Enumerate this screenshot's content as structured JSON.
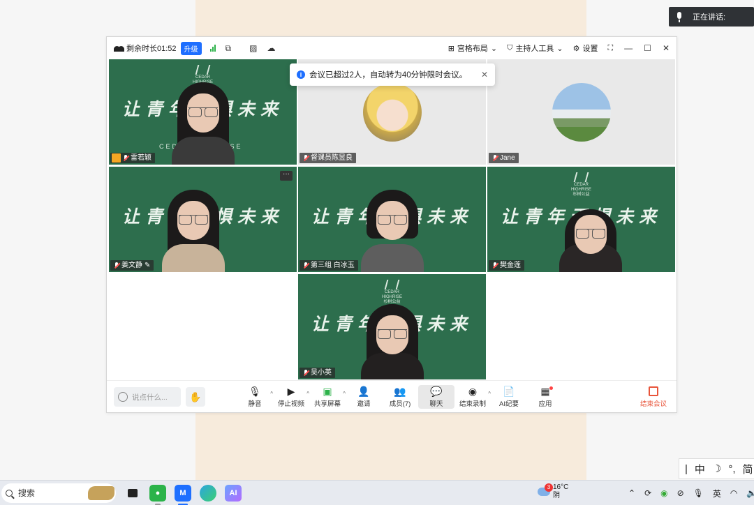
{
  "speaking_bar": {
    "label": "正在讲话:"
  },
  "window": {
    "remaining": "剩余时长01:52",
    "upgrade": "升级",
    "layout": "宫格布局",
    "host_tools": "主持人工具",
    "settings": "设置"
  },
  "toast": {
    "message": "会议已超过2人，自动转为40分钟限时会议。"
  },
  "slogan": "让青年无惧未来",
  "brand": {
    "line1": "CEDAR",
    "line2": "HIGHRISE",
    "line3": "杉树公益",
    "watermark": "CEDAR HIGHRISE"
  },
  "participants": [
    {
      "name": "雷若颖",
      "role": "host"
    },
    {
      "name": "督课员陈昱良"
    },
    {
      "name": "Jane"
    },
    {
      "name": "姜文静"
    },
    {
      "name": "第三组 白冰玉"
    },
    {
      "name": "樊金莲"
    },
    {
      "name": "吴小英"
    }
  ],
  "toolbar": {
    "chat_placeholder": "说点什么...",
    "mute": "静音",
    "stop_video": "停止视频",
    "share": "共享屏幕",
    "invite": "邀请",
    "members": "成员(7)",
    "chat": "聊天",
    "record": "结束录制",
    "ai_notes": "AI纪要",
    "apps": "应用",
    "end": "结束会议"
  },
  "ime": {
    "chars": [
      "中",
      "☽",
      "°,",
      "简"
    ]
  },
  "taskbar": {
    "search": "搜索",
    "weather_temp": "16°C",
    "weather_desc": "阴",
    "weather_badge": "3",
    "lang": "英"
  },
  "colors": {
    "accent": "#1e6fff",
    "tile_green": "#2d6e4d",
    "end": "#e8543a"
  }
}
